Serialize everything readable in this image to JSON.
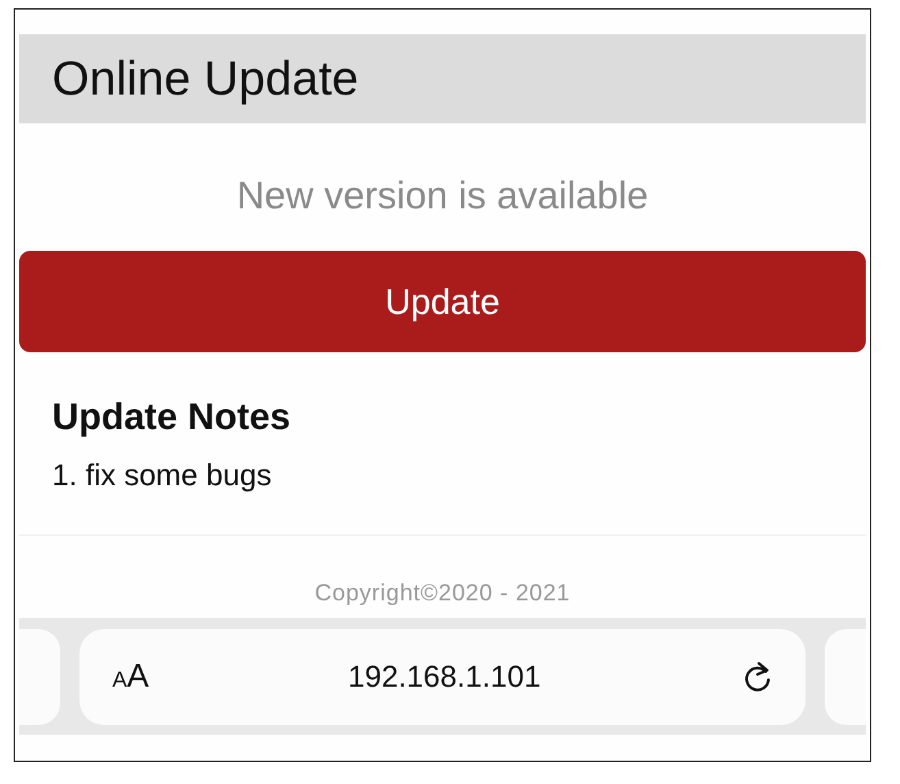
{
  "header": {
    "title": "Online Update"
  },
  "status": "New version is available",
  "update_button": "Update",
  "notes": {
    "heading": "Update Notes",
    "items": [
      "1. fix some bugs"
    ]
  },
  "footer": "Copyright©2020 - 2021",
  "browser_bar": {
    "text_size_button": "AA",
    "url": "192.168.1.101"
  }
}
